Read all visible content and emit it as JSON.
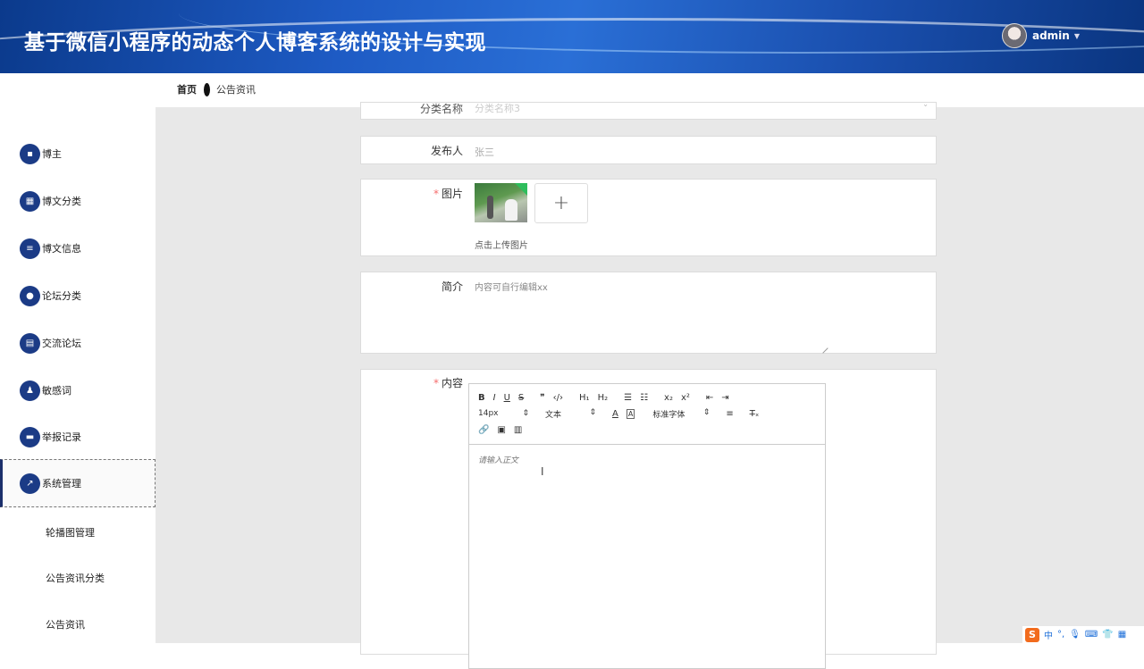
{
  "header": {
    "title": "基于微信小程序的动态个人博客系统的设计与实现",
    "username": "admin"
  },
  "breadcrumb": {
    "home": "首页",
    "current": "公告资讯"
  },
  "sidebar": {
    "items": [
      {
        "label": "博主",
        "icon": "chat-icon"
      },
      {
        "label": "博文分类",
        "icon": "grid-icon"
      },
      {
        "label": "博文信息",
        "icon": "list-icon"
      },
      {
        "label": "论坛分类",
        "icon": "bulb-icon"
      },
      {
        "label": "交流论坛",
        "icon": "clipboard-icon"
      },
      {
        "label": "敏感词",
        "icon": "user-icon"
      },
      {
        "label": "举报记录",
        "icon": "monitor-icon"
      },
      {
        "label": "系统管理",
        "icon": "chart-icon"
      }
    ],
    "subitems": [
      "轮播图管理",
      "公告资讯分类",
      "公告资讯"
    ]
  },
  "form": {
    "category": {
      "label": "分类名称",
      "placeholder": "分类名称3"
    },
    "publisher": {
      "label": "发布人",
      "value": "张三"
    },
    "image": {
      "label": "图片",
      "tip": "点击上传图片",
      "add_symbol": "+"
    },
    "intro": {
      "label": "简介",
      "value": "内容可自行编辑xx"
    },
    "content": {
      "label": "内容",
      "font_size": "14px",
      "text_type": "文本",
      "font_family": "标准字体",
      "placeholder": "请输入正文"
    }
  },
  "ime": {
    "logo": "S",
    "lang": "中"
  }
}
